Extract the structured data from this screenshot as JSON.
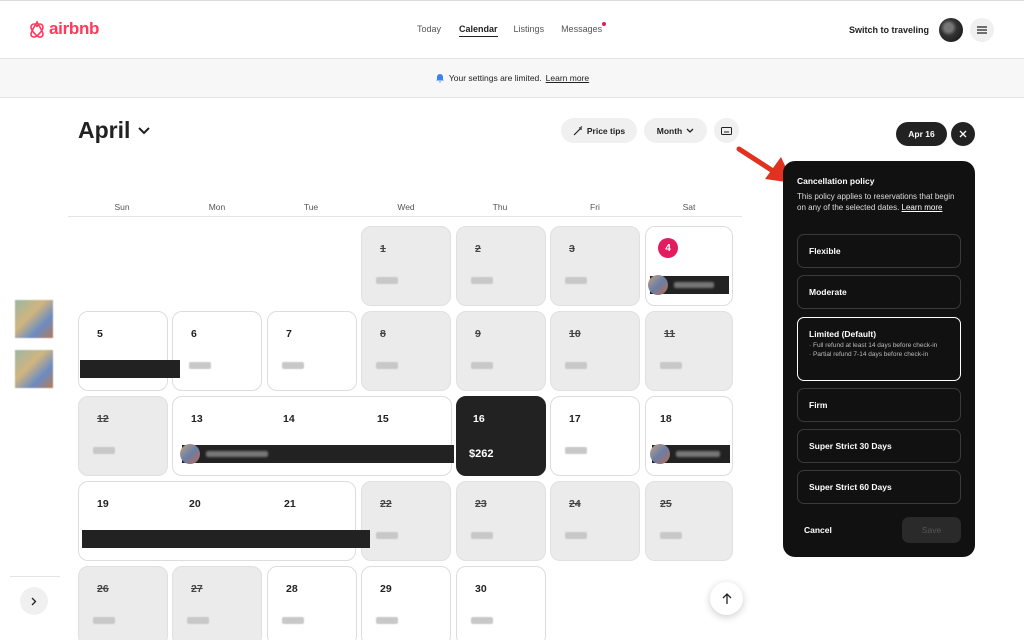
{
  "header": {
    "logo_text": "airbnb",
    "nav": [
      "Today",
      "Calendar",
      "Listings",
      "Messages"
    ],
    "active_nav": "Calendar",
    "switch_label": "Switch to traveling",
    "brand_color": "#ff385c"
  },
  "banner": {
    "text": "Your settings are limited.",
    "link": "Learn more"
  },
  "calendar": {
    "month": "April",
    "price_tips": "Price tips",
    "view_select": "Month",
    "weekdays": [
      "Sun",
      "Mon",
      "Tue",
      "Wed",
      "Thu",
      "Fri",
      "Sat"
    ],
    "selected_price": "$262"
  },
  "panel": {
    "date_chip": "Apr 16",
    "title": "Cancellation policy",
    "description": "This policy applies to reservations that begin on any of the selected dates.",
    "learn_more": "Learn more",
    "options": [
      {
        "label": "Flexible"
      },
      {
        "label": "Moderate"
      },
      {
        "label": "Limited (Default)",
        "details": [
          "· Full refund at least 14 days before check-in",
          "· Partial refund 7-14 days before check-in"
        ]
      },
      {
        "label": "Firm"
      },
      {
        "label": "Super Strict 30 Days"
      },
      {
        "label": "Super Strict 60 Days"
      }
    ],
    "cancel": "Cancel",
    "save": "Save"
  }
}
